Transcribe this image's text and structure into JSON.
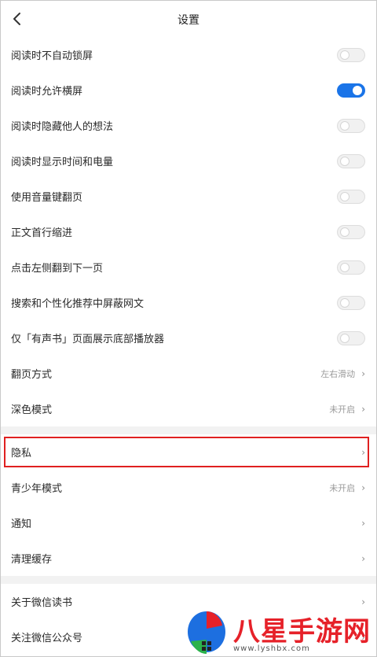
{
  "header": {
    "title": "设置",
    "back_icon": "chevron-left-icon"
  },
  "toggles": [
    {
      "label": "阅读时不自动锁屏",
      "on": false
    },
    {
      "label": "阅读时允许横屏",
      "on": true
    },
    {
      "label": "阅读时隐藏他人的想法",
      "on": false
    },
    {
      "label": "阅读时显示时间和电量",
      "on": false
    },
    {
      "label": "使用音量键翻页",
      "on": false
    },
    {
      "label": "正文首行缩进",
      "on": false
    },
    {
      "label": "点击左侧翻到下一页",
      "on": false
    },
    {
      "label": "搜索和个性化推荐中屏蔽网文",
      "on": false
    },
    {
      "label": "仅「有声书」页面展示底部播放器",
      "on": false
    }
  ],
  "page_turn": {
    "label": "翻页方式",
    "value": "左右滑动"
  },
  "dark_mode": {
    "label": "深色模式",
    "value": "未开启"
  },
  "privacy": {
    "label": "隐私"
  },
  "youth_mode": {
    "label": "青少年模式",
    "value": "未开启"
  },
  "notify": {
    "label": "通知"
  },
  "clear_cache": {
    "label": "清理缓存"
  },
  "about": {
    "label": "关于微信读书"
  },
  "follow": {
    "label": "关注微信公众号"
  },
  "chevron": "›",
  "watermark": {
    "text": "八星手游网",
    "url": "www.lyshbx.com"
  },
  "colors": {
    "accent": "#1a74e8",
    "highlight": "#e02020",
    "section_gap": "#f2f2f2"
  }
}
